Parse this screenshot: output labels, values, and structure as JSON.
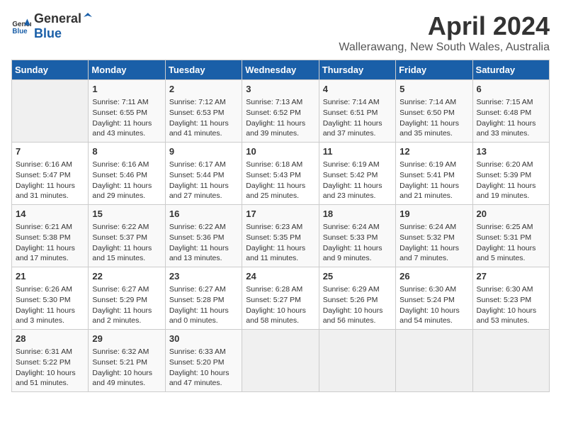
{
  "logo": {
    "text_general": "General",
    "text_blue": "Blue"
  },
  "title": "April 2024",
  "location": "Wallerawang, New South Wales, Australia",
  "days_of_week": [
    "Sunday",
    "Monday",
    "Tuesday",
    "Wednesday",
    "Thursday",
    "Friday",
    "Saturday"
  ],
  "weeks": [
    [
      {
        "day": "",
        "info": ""
      },
      {
        "day": "1",
        "info": "Sunrise: 7:11 AM\nSunset: 6:55 PM\nDaylight: 11 hours\nand 43 minutes."
      },
      {
        "day": "2",
        "info": "Sunrise: 7:12 AM\nSunset: 6:53 PM\nDaylight: 11 hours\nand 41 minutes."
      },
      {
        "day": "3",
        "info": "Sunrise: 7:13 AM\nSunset: 6:52 PM\nDaylight: 11 hours\nand 39 minutes."
      },
      {
        "day": "4",
        "info": "Sunrise: 7:14 AM\nSunset: 6:51 PM\nDaylight: 11 hours\nand 37 minutes."
      },
      {
        "day": "5",
        "info": "Sunrise: 7:14 AM\nSunset: 6:50 PM\nDaylight: 11 hours\nand 35 minutes."
      },
      {
        "day": "6",
        "info": "Sunrise: 7:15 AM\nSunset: 6:48 PM\nDaylight: 11 hours\nand 33 minutes."
      }
    ],
    [
      {
        "day": "7",
        "info": "Sunrise: 6:16 AM\nSunset: 5:47 PM\nDaylight: 11 hours\nand 31 minutes."
      },
      {
        "day": "8",
        "info": "Sunrise: 6:16 AM\nSunset: 5:46 PM\nDaylight: 11 hours\nand 29 minutes."
      },
      {
        "day": "9",
        "info": "Sunrise: 6:17 AM\nSunset: 5:44 PM\nDaylight: 11 hours\nand 27 minutes."
      },
      {
        "day": "10",
        "info": "Sunrise: 6:18 AM\nSunset: 5:43 PM\nDaylight: 11 hours\nand 25 minutes."
      },
      {
        "day": "11",
        "info": "Sunrise: 6:19 AM\nSunset: 5:42 PM\nDaylight: 11 hours\nand 23 minutes."
      },
      {
        "day": "12",
        "info": "Sunrise: 6:19 AM\nSunset: 5:41 PM\nDaylight: 11 hours\nand 21 minutes."
      },
      {
        "day": "13",
        "info": "Sunrise: 6:20 AM\nSunset: 5:39 PM\nDaylight: 11 hours\nand 19 minutes."
      }
    ],
    [
      {
        "day": "14",
        "info": "Sunrise: 6:21 AM\nSunset: 5:38 PM\nDaylight: 11 hours\nand 17 minutes."
      },
      {
        "day": "15",
        "info": "Sunrise: 6:22 AM\nSunset: 5:37 PM\nDaylight: 11 hours\nand 15 minutes."
      },
      {
        "day": "16",
        "info": "Sunrise: 6:22 AM\nSunset: 5:36 PM\nDaylight: 11 hours\nand 13 minutes."
      },
      {
        "day": "17",
        "info": "Sunrise: 6:23 AM\nSunset: 5:35 PM\nDaylight: 11 hours\nand 11 minutes."
      },
      {
        "day": "18",
        "info": "Sunrise: 6:24 AM\nSunset: 5:33 PM\nDaylight: 11 hours\nand 9 minutes."
      },
      {
        "day": "19",
        "info": "Sunrise: 6:24 AM\nSunset: 5:32 PM\nDaylight: 11 hours\nand 7 minutes."
      },
      {
        "day": "20",
        "info": "Sunrise: 6:25 AM\nSunset: 5:31 PM\nDaylight: 11 hours\nand 5 minutes."
      }
    ],
    [
      {
        "day": "21",
        "info": "Sunrise: 6:26 AM\nSunset: 5:30 PM\nDaylight: 11 hours\nand 3 minutes."
      },
      {
        "day": "22",
        "info": "Sunrise: 6:27 AM\nSunset: 5:29 PM\nDaylight: 11 hours\nand 2 minutes."
      },
      {
        "day": "23",
        "info": "Sunrise: 6:27 AM\nSunset: 5:28 PM\nDaylight: 11 hours\nand 0 minutes."
      },
      {
        "day": "24",
        "info": "Sunrise: 6:28 AM\nSunset: 5:27 PM\nDaylight: 10 hours\nand 58 minutes."
      },
      {
        "day": "25",
        "info": "Sunrise: 6:29 AM\nSunset: 5:26 PM\nDaylight: 10 hours\nand 56 minutes."
      },
      {
        "day": "26",
        "info": "Sunrise: 6:30 AM\nSunset: 5:24 PM\nDaylight: 10 hours\nand 54 minutes."
      },
      {
        "day": "27",
        "info": "Sunrise: 6:30 AM\nSunset: 5:23 PM\nDaylight: 10 hours\nand 53 minutes."
      }
    ],
    [
      {
        "day": "28",
        "info": "Sunrise: 6:31 AM\nSunset: 5:22 PM\nDaylight: 10 hours\nand 51 minutes."
      },
      {
        "day": "29",
        "info": "Sunrise: 6:32 AM\nSunset: 5:21 PM\nDaylight: 10 hours\nand 49 minutes."
      },
      {
        "day": "30",
        "info": "Sunrise: 6:33 AM\nSunset: 5:20 PM\nDaylight: 10 hours\nand 47 minutes."
      },
      {
        "day": "",
        "info": ""
      },
      {
        "day": "",
        "info": ""
      },
      {
        "day": "",
        "info": ""
      },
      {
        "day": "",
        "info": ""
      }
    ]
  ]
}
